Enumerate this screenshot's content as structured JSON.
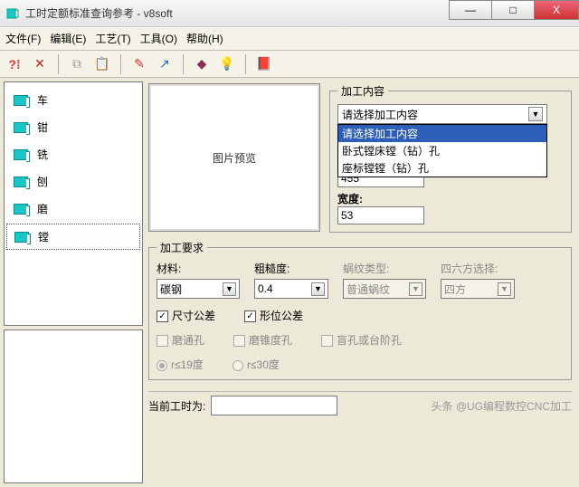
{
  "window": {
    "title": "工时定额标准查询参考 - v8soft",
    "minimize": "—",
    "maximize": "□",
    "close": "X"
  },
  "menu": {
    "file": "文件(F)",
    "edit": "编辑(E)",
    "craft": "工艺(T)",
    "tools": "工具(O)",
    "help": "帮助(H)"
  },
  "toolbar_icons": {
    "help": "?⁞",
    "delete": "✕",
    "copy": "⧉",
    "paste": "📋",
    "wand": "✎",
    "tune": "↗",
    "book": "◆",
    "bulb": "💡",
    "chart": "📕"
  },
  "nav": {
    "items": [
      {
        "label": "车"
      },
      {
        "label": "钳"
      },
      {
        "label": "铣"
      },
      {
        "label": "刨"
      },
      {
        "label": "磨"
      },
      {
        "label": "镗"
      }
    ]
  },
  "preview_label": "图片预览",
  "content_group": {
    "legend": "加工内容",
    "combo_label": "请选择加工内容",
    "options": [
      "请选择加工内容",
      "卧式镗床镗（钻）孔",
      "座标镗镗（钻）孔"
    ],
    "value1": "455",
    "width_label": "宽度:",
    "width_value": "53"
  },
  "req_group": {
    "legend": "加工要求",
    "material_label": "材料:",
    "material_value": "碳钢",
    "rough_label": "粗糙度:",
    "rough_value": "0.4",
    "thread_label": "蜗纹类型:",
    "thread_value": "普通蜗纹",
    "square_label": "四六方选择:",
    "square_value": "四方",
    "tol_dim": "尺寸公差",
    "tol_pos": "形位公差",
    "opt_through": "磨通孔",
    "opt_taper": "磨锥度孔",
    "opt_blind": "盲孔或台阶孔",
    "radio_r19": "r≤19度",
    "radio_r30": "r≤30度"
  },
  "footer": {
    "cur_label": "当前工时为:",
    "watermark": "头条 @UG编程数控CNC加工"
  }
}
